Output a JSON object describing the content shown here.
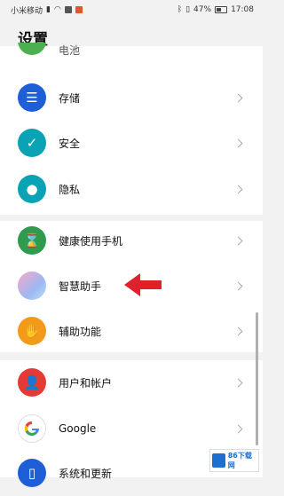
{
  "status_bar": {
    "carrier": "小米移动",
    "battery": "47%",
    "time": "17:08"
  },
  "title": "设置",
  "items": [
    {
      "label": "电池",
      "icon": "battery-icon",
      "color": "#4caf50"
    },
    {
      "label": "存储",
      "icon": "storage-icon",
      "color": "#1e5fd8"
    },
    {
      "label": "安全",
      "icon": "security-shield-icon",
      "color": "#0aa3b5"
    },
    {
      "label": "隐私",
      "icon": "privacy-icon",
      "color": "#0aa3b5"
    },
    {
      "label": "健康使用手机",
      "icon": "hourglass-icon",
      "color": "#2e9b4e"
    },
    {
      "label": "智慧助手",
      "icon": "smart-assistant-icon",
      "color": "#a6b8f0"
    },
    {
      "label": "辅助功能",
      "icon": "hand-icon",
      "color": "#f29a1a"
    },
    {
      "label": "用户和帐户",
      "icon": "user-icon",
      "color": "#e53935"
    },
    {
      "label": "Google",
      "icon": "google-icon",
      "color": "#ffffff"
    },
    {
      "label": "系统和更新",
      "icon": "phone-icon",
      "color": "#1e5fd8"
    }
  ],
  "annotation_arrow_color": "#e0202a",
  "watermark": {
    "text": "86下载网"
  }
}
